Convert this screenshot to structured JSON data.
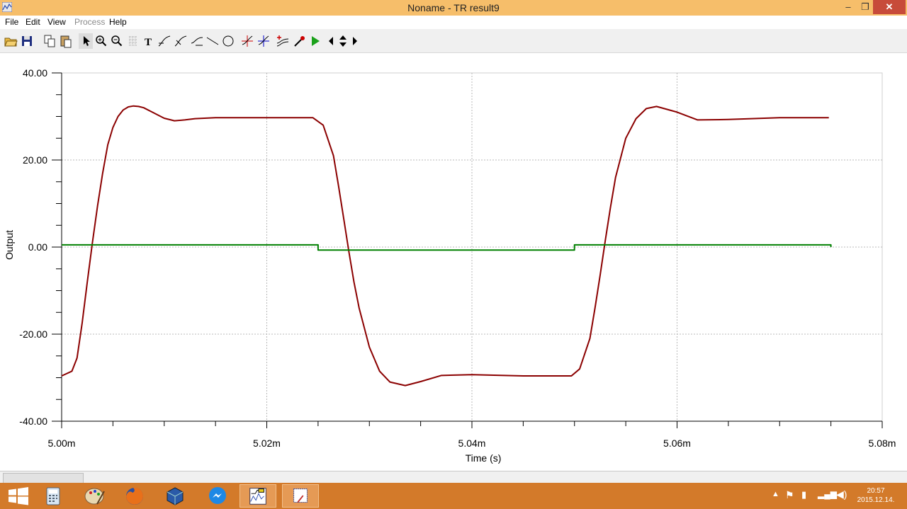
{
  "window": {
    "title": "Noname - TR result9"
  },
  "menu": {
    "file": "File",
    "edit": "Edit",
    "view": "View",
    "process": "Process",
    "help": "Help"
  },
  "controls": {
    "minimize": "‒",
    "restore": "❐",
    "close": "✕"
  },
  "toolbar": {
    "icons": [
      "open-folder-icon",
      "save-icon",
      "copy-icon",
      "paste-icon",
      "pointer-icon",
      "zoom-in-icon",
      "zoom-out-icon",
      "grid-icon",
      "text-icon",
      "curve-icon",
      "curve2-icon",
      "curve3-icon",
      "line-icon",
      "circle-icon",
      "cursor-a-icon",
      "cursor-b-icon",
      "add-curve-icon",
      "probe-icon",
      "run-icon",
      "left-arrow-icon",
      "updown-arrow-icon",
      "right-arrow-icon"
    ]
  },
  "chart_data": {
    "type": "line",
    "xlabel": "Time (s)",
    "ylabel": "Output",
    "xlim": [
      5.0,
      5.08
    ],
    "ylim": [
      -40,
      40
    ],
    "x_ticks": [
      "5.00m",
      "5.02m",
      "5.04m",
      "5.06m",
      "5.08m"
    ],
    "y_ticks": [
      "40.00",
      "20.00",
      "0.00",
      "-20.00",
      "-40.00"
    ],
    "grid": true,
    "x_unit_note": "ms",
    "series": [
      {
        "color": "#8b0000",
        "x": [
          5.0,
          5.001,
          5.0015,
          5.002,
          5.0025,
          5.003,
          5.0035,
          5.004,
          5.0045,
          5.005,
          5.0055,
          5.006,
          5.0065,
          5.007,
          5.0075,
          5.008,
          5.009,
          5.01,
          5.011,
          5.012,
          5.013,
          5.015,
          5.02,
          5.0245,
          5.0255,
          5.0265,
          5.027,
          5.0275,
          5.028,
          5.0285,
          5.029,
          5.03,
          5.031,
          5.032,
          5.0335,
          5.035,
          5.037,
          5.04,
          5.045,
          5.0497,
          5.0505,
          5.0515,
          5.052,
          5.0525,
          5.053,
          5.0535,
          5.054,
          5.055,
          5.056,
          5.057,
          5.058,
          5.06,
          5.062,
          5.065,
          5.07,
          5.0748
        ],
        "y": [
          -29.6,
          -28.5,
          -25.5,
          -17.5,
          -8.0,
          1.0,
          9.5,
          17.0,
          23.5,
          27.5,
          30.0,
          31.5,
          32.2,
          32.4,
          32.3,
          32.0,
          30.8,
          29.6,
          29.0,
          29.2,
          29.5,
          29.7,
          29.7,
          29.7,
          28.0,
          21.0,
          14.0,
          6.5,
          -1.0,
          -8.0,
          -14.0,
          -23.0,
          -28.5,
          -31.0,
          -31.8,
          -30.9,
          -29.5,
          -29.3,
          -29.6,
          -29.6,
          -28.0,
          -21.0,
          -14.0,
          -6.5,
          1.5,
          9.0,
          16.0,
          25.0,
          29.5,
          31.8,
          32.3,
          31.0,
          29.2,
          29.3,
          29.7,
          29.7
        ]
      },
      {
        "color": "#008000",
        "x": [
          5.0,
          5.025,
          5.025,
          5.05,
          5.05,
          5.075,
          5.075
        ],
        "y": [
          0.5,
          0.5,
          -0.7,
          -0.7,
          0.5,
          0.5,
          0.0
        ]
      }
    ]
  },
  "taskbar": {
    "apps": [
      "windows-start-icon",
      "calculator-icon",
      "paint-icon",
      "firefox-icon",
      "virtualbox-icon",
      "messenger-icon",
      "tina-icon",
      "snipping-icon"
    ],
    "time": "20:57",
    "date": "2015.12.14."
  }
}
